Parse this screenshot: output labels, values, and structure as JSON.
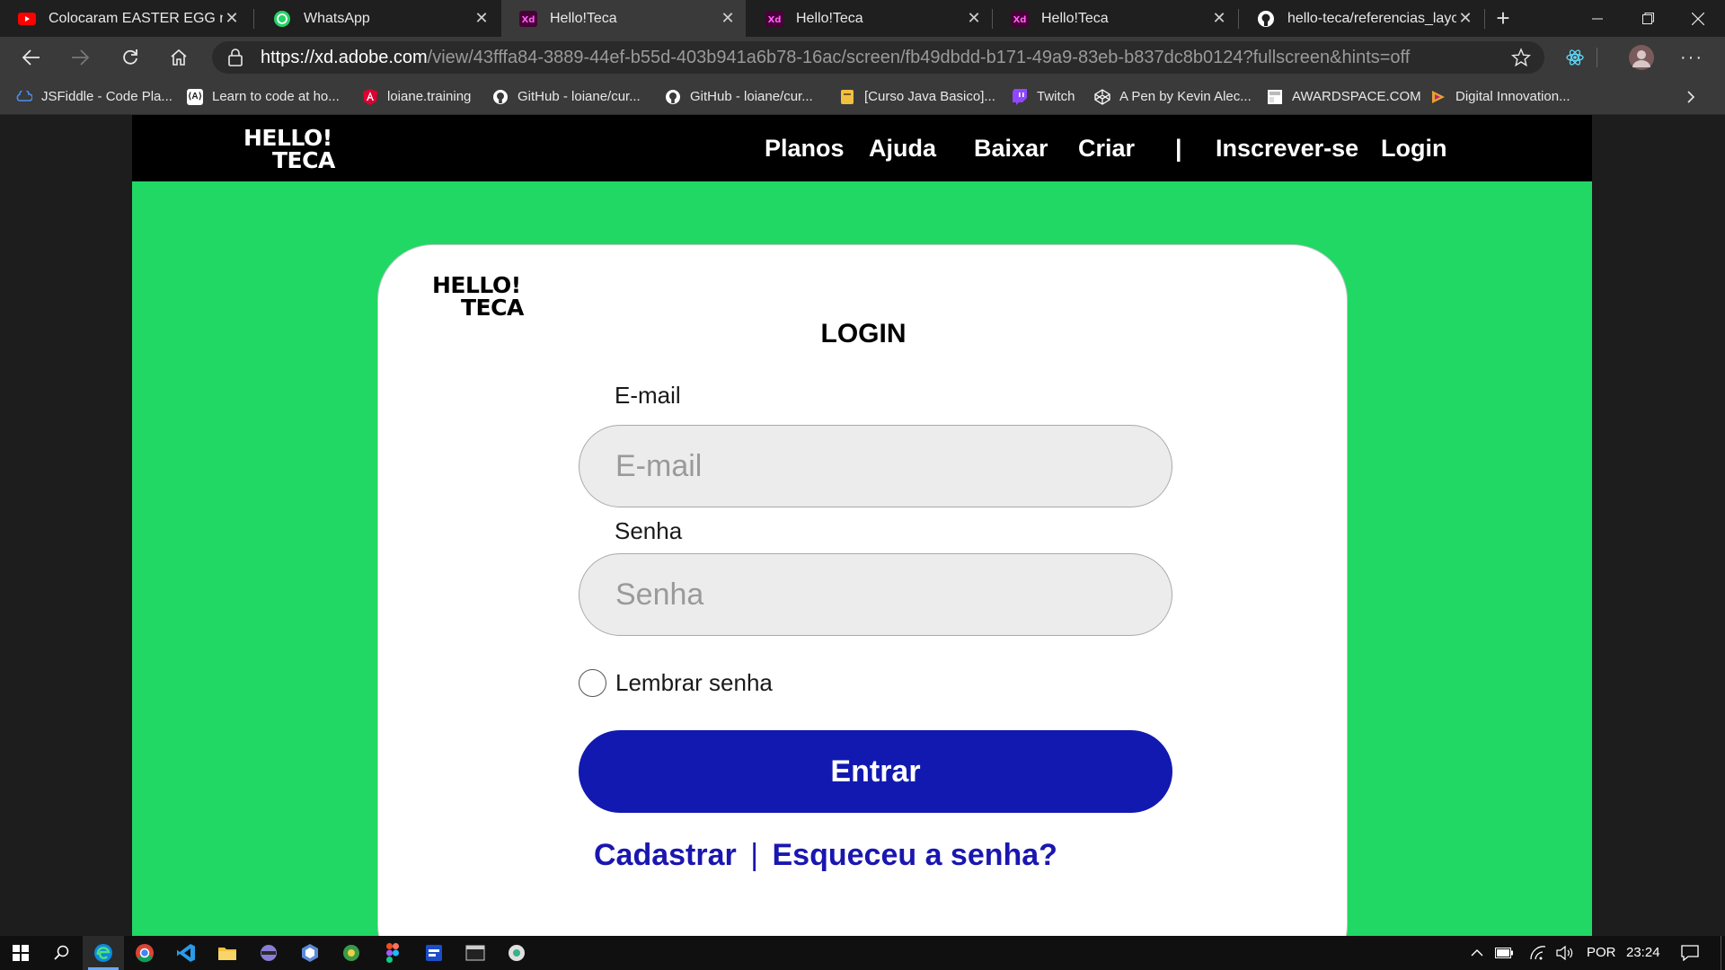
{
  "browser": {
    "tabs": [
      {
        "title": "Colocaram EASTER EGG na D",
        "icon": "youtube-icon",
        "active": false
      },
      {
        "title": "WhatsApp",
        "icon": "whatsapp-icon",
        "active": false
      },
      {
        "title": "Hello!Teca",
        "icon": "adobe-xd-icon",
        "active": true
      },
      {
        "title": "Hello!Teca",
        "icon": "adobe-xd-icon",
        "active": false
      },
      {
        "title": "Hello!Teca",
        "icon": "adobe-xd-icon",
        "active": false
      },
      {
        "title": "hello-teca/referencias_layout",
        "icon": "github-icon",
        "active": false
      }
    ],
    "url_base": "https://xd.adobe.com",
    "url_path": "/view/43fffa84-3889-44ef-b55d-403b941a6b78-16ac/screen/fb49dbdd-b171-49a9-83eb-b837dc8b0124?fullscreen&hints=off",
    "bookmarks": [
      {
        "label": "JSFiddle - Code Pla...",
        "icon": "jsfiddle-icon"
      },
      {
        "label": "Learn to code at ho...",
        "icon": "codecademy-icon"
      },
      {
        "label": "loiane.training",
        "icon": "angular-icon"
      },
      {
        "label": "GitHub - loiane/cur...",
        "icon": "github-icon"
      },
      {
        "label": "GitHub - loiane/cur...",
        "icon": "github-icon"
      },
      {
        "label": "[Curso Java Basico]...",
        "icon": "page-icon"
      },
      {
        "label": "Twitch",
        "icon": "twitch-icon"
      },
      {
        "label": "A Pen by Kevin Alec...",
        "icon": "codepen-icon"
      },
      {
        "label": "AWARDSPACE.COM",
        "icon": "awardspace-icon"
      },
      {
        "label": "Digital Innovation...",
        "icon": "dio-icon"
      }
    ]
  },
  "site": {
    "logo_line1": "HELLO!",
    "logo_line2": "TECA",
    "nav": [
      "Planos",
      "Ajuda",
      "Baixar",
      "Criar",
      "|",
      "Inscrever-se",
      "Login"
    ]
  },
  "login": {
    "title": "LOGIN",
    "email_label": "E-mail",
    "email_placeholder": "E-mail",
    "password_label": "Senha",
    "password_placeholder": "Senha",
    "remember_label": "Lembrar senha",
    "submit_label": "Entrar",
    "signup_link": "Cadastrar",
    "separator": "|",
    "forgot_link": "Esqueceu a senha?"
  },
  "taskbar": {
    "language": "POR",
    "time": "23:24"
  },
  "colors": {
    "page_green": "#21d865",
    "nav_black": "#000000",
    "button_blue": "#1219b0",
    "link_blue": "#1a16b0"
  }
}
